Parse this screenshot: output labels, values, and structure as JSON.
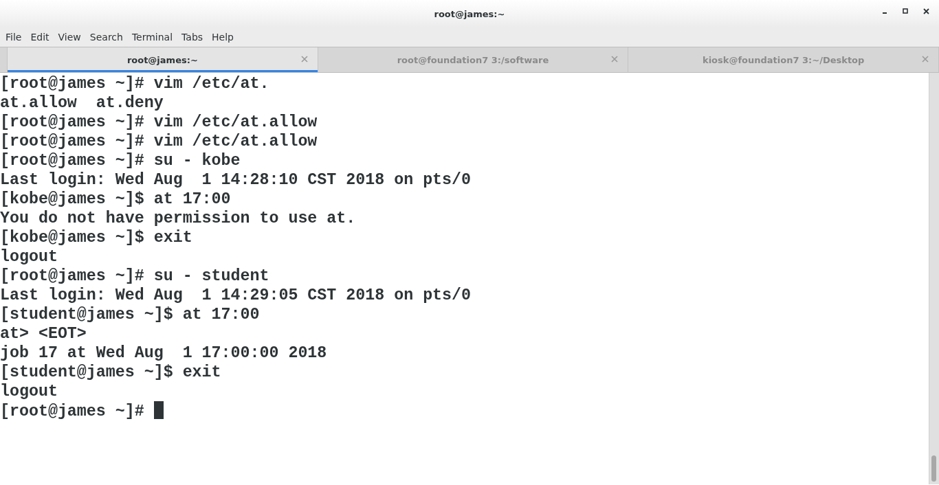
{
  "window": {
    "title": "root@james:~"
  },
  "menu": [
    "File",
    "Edit",
    "View",
    "Search",
    "Terminal",
    "Tabs",
    "Help"
  ],
  "tabs": [
    {
      "label": "root@james:~",
      "selected": true
    },
    {
      "label": "root@foundation7 3:/software",
      "selected": false
    },
    {
      "label": "kiosk@foundation7 3:~/Desktop",
      "selected": false
    }
  ],
  "terminal": {
    "cursor": true,
    "lines": [
      "[root@james ~]# vim /etc/at.",
      "at.allow  at.deny",
      "[root@james ~]# vim /etc/at.allow",
      "[root@james ~]# vim /etc/at.allow",
      "[root@james ~]# su - kobe",
      "Last login: Wed Aug  1 14:28:10 CST 2018 on pts/0",
      "[kobe@james ~]$ at 17:00",
      "You do not have permission to use at.",
      "[kobe@james ~]$ exit",
      "logout",
      "[root@james ~]# su - student",
      "Last login: Wed Aug  1 14:29:05 CST 2018 on pts/0",
      "[student@james ~]$ at 17:00",
      "at> <EOT>",
      "job 17 at Wed Aug  1 17:00:00 2018",
      "[student@james ~]$ exit",
      "logout",
      "[root@james ~]# "
    ]
  }
}
